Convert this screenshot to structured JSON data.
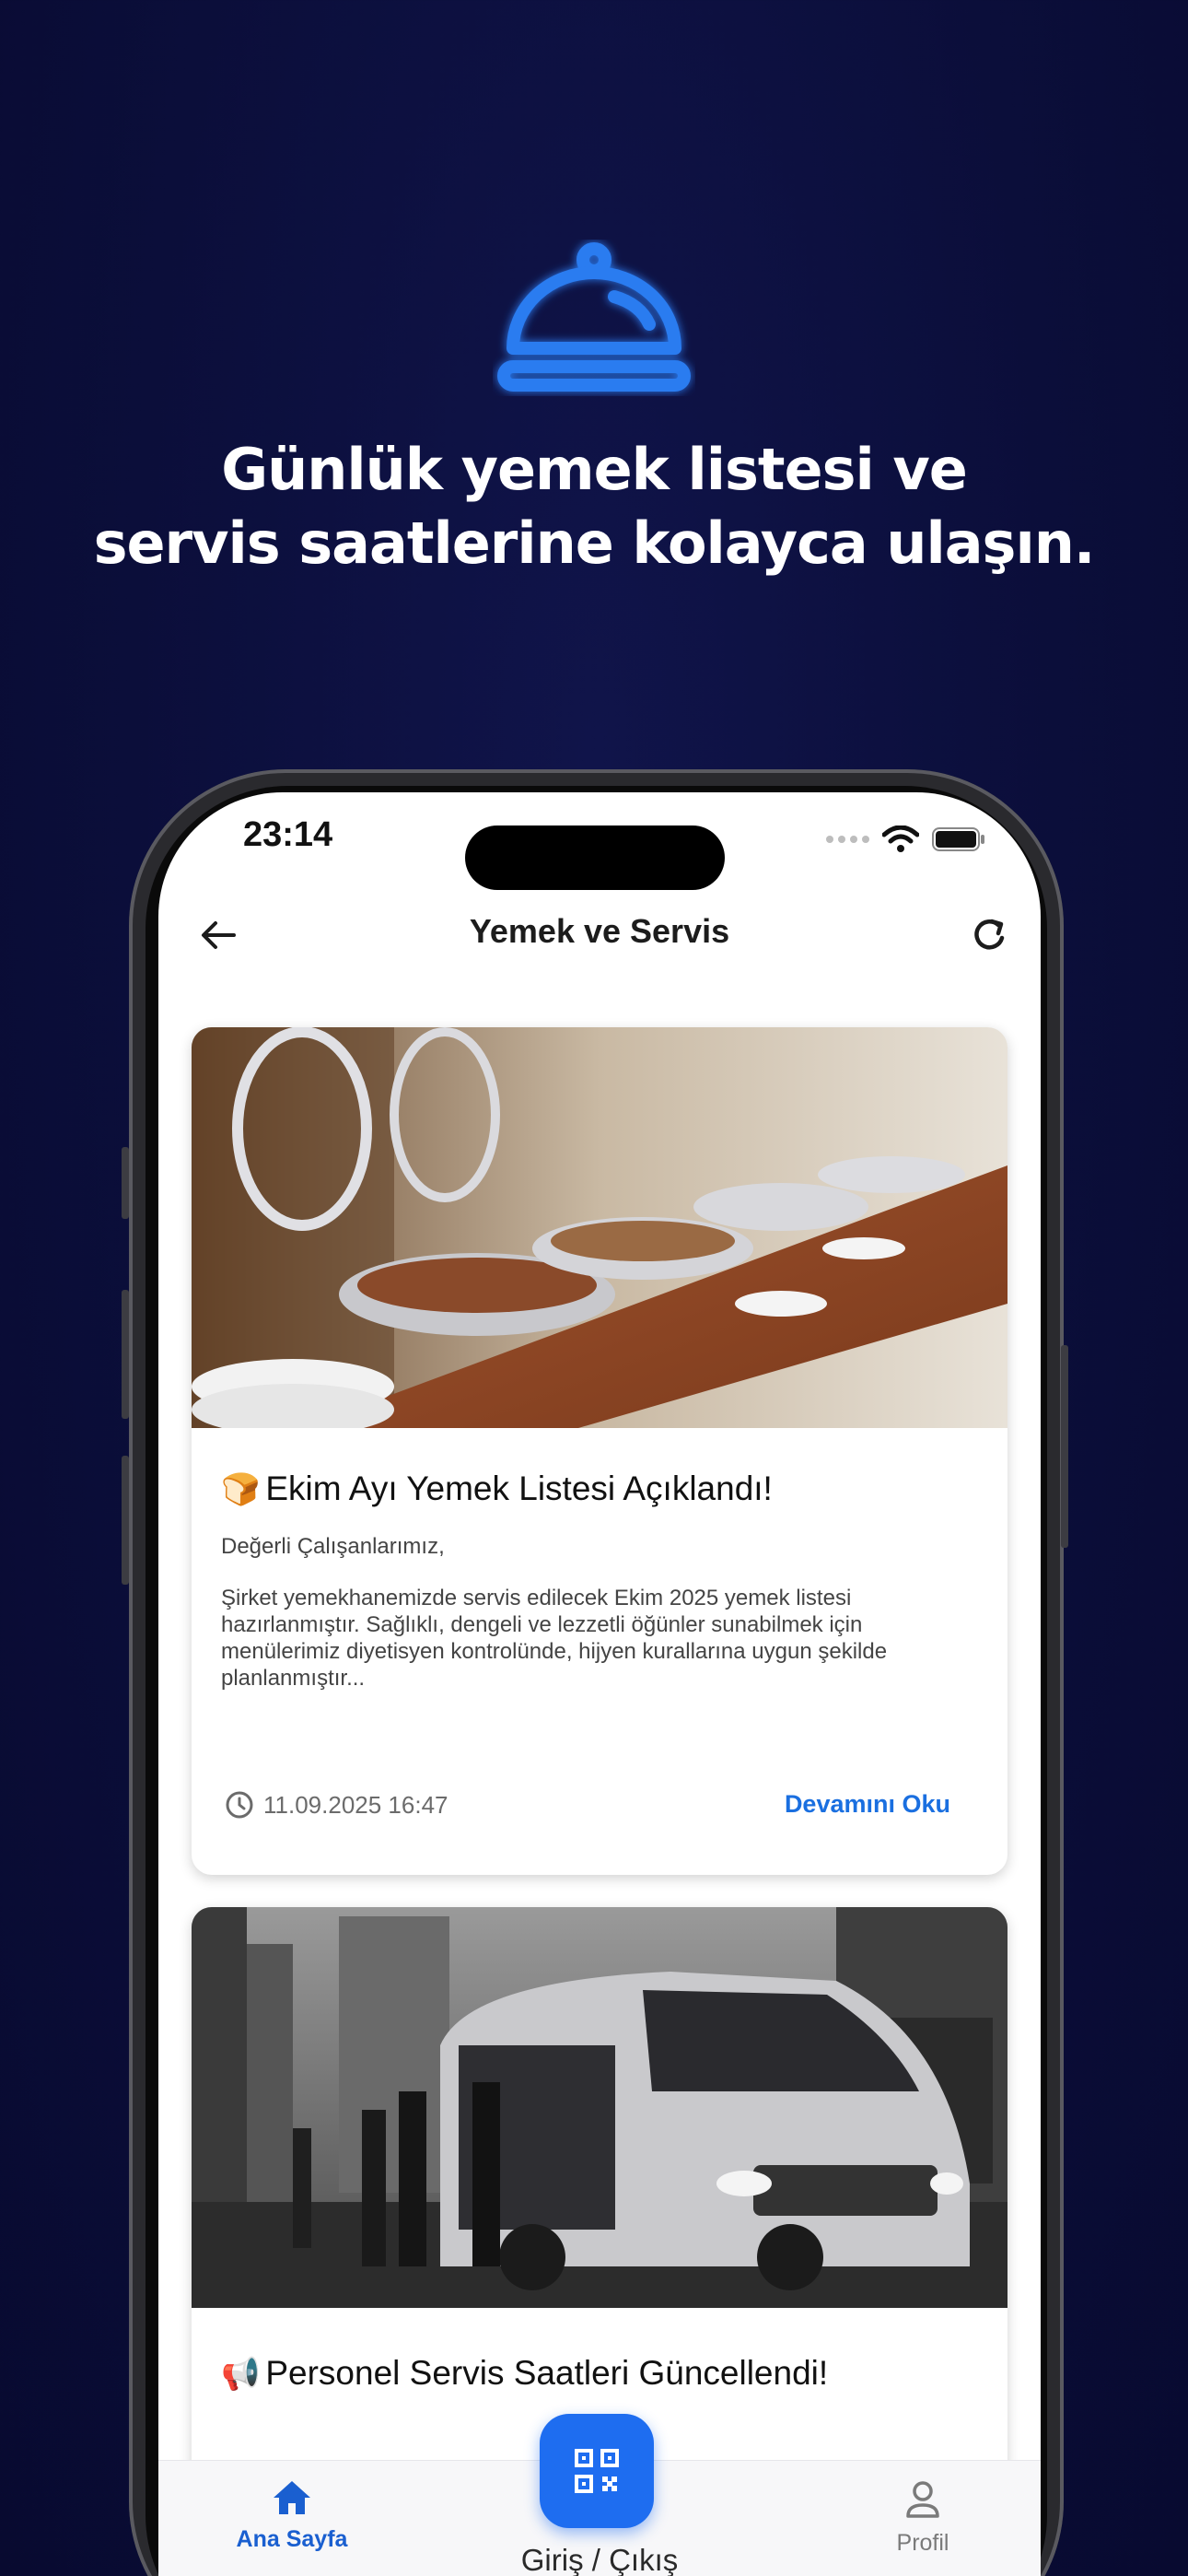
{
  "headline": {
    "line1": "Günlük yemek listesi ve",
    "line2": "servis saatlerine kolayca ulaşın."
  },
  "status_bar": {
    "time": "23:14"
  },
  "nav": {
    "title": "Yemek ve Servis"
  },
  "cards": [
    {
      "emoji": "🍞",
      "title": "Ekim Ayı Yemek Listesi Açıklandı!",
      "greeting": "Değerli Çalışanlarımız,",
      "body": "Şirket yemekhanemizde servis edilecek Ekim 2025 yemek listesi hazırlanmıştır. Sağlıklı, dengeli ve lezzetli öğünler sunabilmek için menülerimiz diyetisyen kontrolünde, hijyen kurallarına uygun şekilde planlanmıştır...",
      "date": "11.09.2025 16:47",
      "read_more": "Devamını Oku"
    },
    {
      "emoji": "📢",
      "title": "Personel Servis Saatleri Güncellendi!"
    }
  ],
  "tabs": {
    "home": "Ana Sayfa",
    "checkin": "Giriş / Çıkış",
    "profile": "Profil"
  },
  "colors": {
    "background": "#0b0e3a",
    "accent": "#1e6df0",
    "link": "#1a6fe0"
  }
}
